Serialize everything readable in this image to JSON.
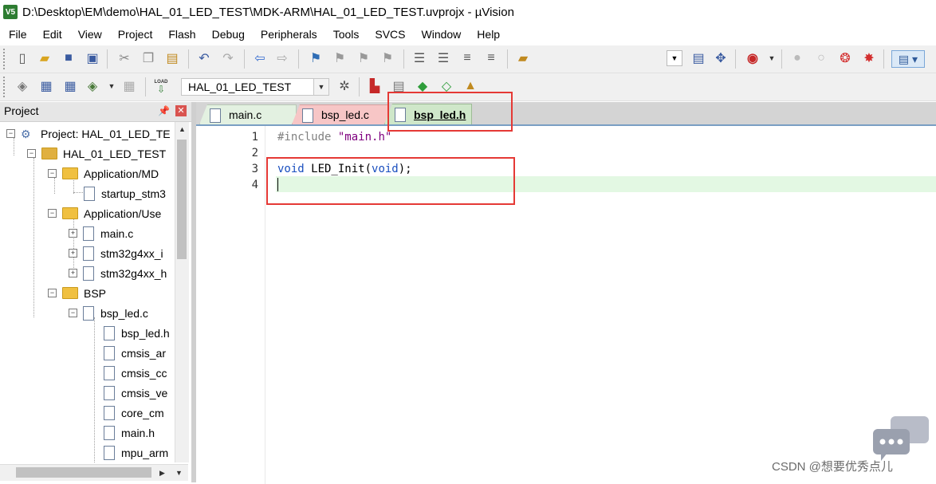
{
  "window": {
    "title": "D:\\Desktop\\EM\\demo\\HAL_01_LED_TEST\\MDK-ARM\\HAL_01_LED_TEST.uvprojx - µVision",
    "app_icon_label": "V5"
  },
  "menu": [
    "File",
    "Edit",
    "View",
    "Project",
    "Flash",
    "Debug",
    "Peripherals",
    "Tools",
    "SVCS",
    "Window",
    "Help"
  ],
  "toolbar2": {
    "load_label": "LOAD",
    "target": "HAL_01_LED_TEST"
  },
  "project_pane": {
    "title": "Project",
    "tree": [
      {
        "label": "Project: HAL_01_LED_TE",
        "level": 0,
        "expander": "−",
        "icon": "project-icon"
      },
      {
        "label": "HAL_01_LED_TEST",
        "level": 1,
        "expander": "−",
        "icon": "target-folder-icon"
      },
      {
        "label": "Application/MD",
        "level": 2,
        "expander": "−",
        "icon": "folder-icon"
      },
      {
        "label": "startup_stm3",
        "level": 3,
        "expander": "",
        "icon": "file-icon"
      },
      {
        "label": "Application/Use",
        "level": 2,
        "expander": "−",
        "icon": "folder-icon"
      },
      {
        "label": "main.c",
        "level": 3,
        "expander": "+",
        "icon": "file-icon"
      },
      {
        "label": "stm32g4xx_i",
        "level": 3,
        "expander": "+",
        "icon": "file-icon"
      },
      {
        "label": "stm32g4xx_h",
        "level": 3,
        "expander": "+",
        "icon": "file-icon"
      },
      {
        "label": "BSP",
        "level": 2,
        "expander": "−",
        "icon": "folder-icon"
      },
      {
        "label": "bsp_led.c",
        "level": 3,
        "expander": "−",
        "icon": "file-icon"
      },
      {
        "label": "bsp_led.h",
        "level": 4,
        "expander": "",
        "icon": "file-icon"
      },
      {
        "label": "cmsis_ar",
        "level": 4,
        "expander": "",
        "icon": "file-icon"
      },
      {
        "label": "cmsis_cc",
        "level": 4,
        "expander": "",
        "icon": "file-icon"
      },
      {
        "label": "cmsis_ve",
        "level": 4,
        "expander": "",
        "icon": "file-icon"
      },
      {
        "label": "core_cm",
        "level": 4,
        "expander": "",
        "icon": "file-icon"
      },
      {
        "label": "main.h",
        "level": 4,
        "expander": "",
        "icon": "file-icon"
      },
      {
        "label": "mpu_arm",
        "level": 4,
        "expander": "",
        "icon": "file-icon"
      }
    ]
  },
  "tabs": [
    {
      "label": "main.c",
      "active": false
    },
    {
      "label": "bsp_led.c",
      "active": false
    },
    {
      "label": "bsp_led.h",
      "active": true
    }
  ],
  "editor": {
    "line_numbers": [
      "1",
      "2",
      "3",
      "4"
    ],
    "line1": {
      "directive": "#include",
      "space": " ",
      "string": "\"main.h\""
    },
    "line3": {
      "kw1": "void",
      "name": " LED_Init(",
      "kw2": "void",
      "end": ");"
    }
  },
  "watermark": {
    "text": "CSDN @想要优秀点儿"
  },
  "colors": {
    "highlight_box": "#e53935",
    "current_line": "#e3f8e3",
    "keyword": "#1a4fbf",
    "string": "#800080",
    "preprocessor": "#808080"
  }
}
